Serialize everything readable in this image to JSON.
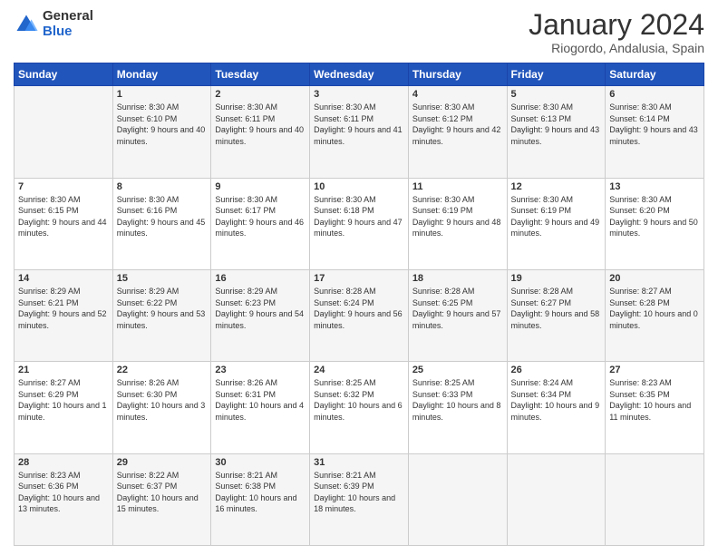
{
  "logo": {
    "general": "General",
    "blue": "Blue"
  },
  "title": "January 2024",
  "subtitle": "Riogordo, Andalusia, Spain",
  "weekdays": [
    "Sunday",
    "Monday",
    "Tuesday",
    "Wednesday",
    "Thursday",
    "Friday",
    "Saturday"
  ],
  "weeks": [
    [
      {
        "day": "",
        "sunrise": "",
        "sunset": "",
        "daylight": ""
      },
      {
        "day": "1",
        "sunrise": "Sunrise: 8:30 AM",
        "sunset": "Sunset: 6:10 PM",
        "daylight": "Daylight: 9 hours and 40 minutes."
      },
      {
        "day": "2",
        "sunrise": "Sunrise: 8:30 AM",
        "sunset": "Sunset: 6:11 PM",
        "daylight": "Daylight: 9 hours and 40 minutes."
      },
      {
        "day": "3",
        "sunrise": "Sunrise: 8:30 AM",
        "sunset": "Sunset: 6:11 PM",
        "daylight": "Daylight: 9 hours and 41 minutes."
      },
      {
        "day": "4",
        "sunrise": "Sunrise: 8:30 AM",
        "sunset": "Sunset: 6:12 PM",
        "daylight": "Daylight: 9 hours and 42 minutes."
      },
      {
        "day": "5",
        "sunrise": "Sunrise: 8:30 AM",
        "sunset": "Sunset: 6:13 PM",
        "daylight": "Daylight: 9 hours and 43 minutes."
      },
      {
        "day": "6",
        "sunrise": "Sunrise: 8:30 AM",
        "sunset": "Sunset: 6:14 PM",
        "daylight": "Daylight: 9 hours and 43 minutes."
      }
    ],
    [
      {
        "day": "7",
        "sunrise": "Sunrise: 8:30 AM",
        "sunset": "Sunset: 6:15 PM",
        "daylight": "Daylight: 9 hours and 44 minutes."
      },
      {
        "day": "8",
        "sunrise": "Sunrise: 8:30 AM",
        "sunset": "Sunset: 6:16 PM",
        "daylight": "Daylight: 9 hours and 45 minutes."
      },
      {
        "day": "9",
        "sunrise": "Sunrise: 8:30 AM",
        "sunset": "Sunset: 6:17 PM",
        "daylight": "Daylight: 9 hours and 46 minutes."
      },
      {
        "day": "10",
        "sunrise": "Sunrise: 8:30 AM",
        "sunset": "Sunset: 6:18 PM",
        "daylight": "Daylight: 9 hours and 47 minutes."
      },
      {
        "day": "11",
        "sunrise": "Sunrise: 8:30 AM",
        "sunset": "Sunset: 6:19 PM",
        "daylight": "Daylight: 9 hours and 48 minutes."
      },
      {
        "day": "12",
        "sunrise": "Sunrise: 8:30 AM",
        "sunset": "Sunset: 6:19 PM",
        "daylight": "Daylight: 9 hours and 49 minutes."
      },
      {
        "day": "13",
        "sunrise": "Sunrise: 8:30 AM",
        "sunset": "Sunset: 6:20 PM",
        "daylight": "Daylight: 9 hours and 50 minutes."
      }
    ],
    [
      {
        "day": "14",
        "sunrise": "Sunrise: 8:29 AM",
        "sunset": "Sunset: 6:21 PM",
        "daylight": "Daylight: 9 hours and 52 minutes."
      },
      {
        "day": "15",
        "sunrise": "Sunrise: 8:29 AM",
        "sunset": "Sunset: 6:22 PM",
        "daylight": "Daylight: 9 hours and 53 minutes."
      },
      {
        "day": "16",
        "sunrise": "Sunrise: 8:29 AM",
        "sunset": "Sunset: 6:23 PM",
        "daylight": "Daylight: 9 hours and 54 minutes."
      },
      {
        "day": "17",
        "sunrise": "Sunrise: 8:28 AM",
        "sunset": "Sunset: 6:24 PM",
        "daylight": "Daylight: 9 hours and 56 minutes."
      },
      {
        "day": "18",
        "sunrise": "Sunrise: 8:28 AM",
        "sunset": "Sunset: 6:25 PM",
        "daylight": "Daylight: 9 hours and 57 minutes."
      },
      {
        "day": "19",
        "sunrise": "Sunrise: 8:28 AM",
        "sunset": "Sunset: 6:27 PM",
        "daylight": "Daylight: 9 hours and 58 minutes."
      },
      {
        "day": "20",
        "sunrise": "Sunrise: 8:27 AM",
        "sunset": "Sunset: 6:28 PM",
        "daylight": "Daylight: 10 hours and 0 minutes."
      }
    ],
    [
      {
        "day": "21",
        "sunrise": "Sunrise: 8:27 AM",
        "sunset": "Sunset: 6:29 PM",
        "daylight": "Daylight: 10 hours and 1 minute."
      },
      {
        "day": "22",
        "sunrise": "Sunrise: 8:26 AM",
        "sunset": "Sunset: 6:30 PM",
        "daylight": "Daylight: 10 hours and 3 minutes."
      },
      {
        "day": "23",
        "sunrise": "Sunrise: 8:26 AM",
        "sunset": "Sunset: 6:31 PM",
        "daylight": "Daylight: 10 hours and 4 minutes."
      },
      {
        "day": "24",
        "sunrise": "Sunrise: 8:25 AM",
        "sunset": "Sunset: 6:32 PM",
        "daylight": "Daylight: 10 hours and 6 minutes."
      },
      {
        "day": "25",
        "sunrise": "Sunrise: 8:25 AM",
        "sunset": "Sunset: 6:33 PM",
        "daylight": "Daylight: 10 hours and 8 minutes."
      },
      {
        "day": "26",
        "sunrise": "Sunrise: 8:24 AM",
        "sunset": "Sunset: 6:34 PM",
        "daylight": "Daylight: 10 hours and 9 minutes."
      },
      {
        "day": "27",
        "sunrise": "Sunrise: 8:23 AM",
        "sunset": "Sunset: 6:35 PM",
        "daylight": "Daylight: 10 hours and 11 minutes."
      }
    ],
    [
      {
        "day": "28",
        "sunrise": "Sunrise: 8:23 AM",
        "sunset": "Sunset: 6:36 PM",
        "daylight": "Daylight: 10 hours and 13 minutes."
      },
      {
        "day": "29",
        "sunrise": "Sunrise: 8:22 AM",
        "sunset": "Sunset: 6:37 PM",
        "daylight": "Daylight: 10 hours and 15 minutes."
      },
      {
        "day": "30",
        "sunrise": "Sunrise: 8:21 AM",
        "sunset": "Sunset: 6:38 PM",
        "daylight": "Daylight: 10 hours and 16 minutes."
      },
      {
        "day": "31",
        "sunrise": "Sunrise: 8:21 AM",
        "sunset": "Sunset: 6:39 PM",
        "daylight": "Daylight: 10 hours and 18 minutes."
      },
      {
        "day": "",
        "sunrise": "",
        "sunset": "",
        "daylight": ""
      },
      {
        "day": "",
        "sunrise": "",
        "sunset": "",
        "daylight": ""
      },
      {
        "day": "",
        "sunrise": "",
        "sunset": "",
        "daylight": ""
      }
    ]
  ]
}
